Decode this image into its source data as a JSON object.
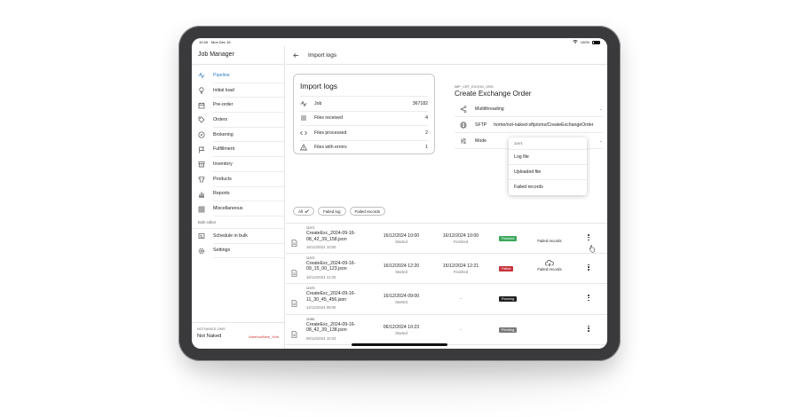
{
  "status_bar": {
    "time": "10:45",
    "date": "Mon Dec 16",
    "battery": "100%"
  },
  "sidebar": {
    "title": "Job Manager",
    "items": [
      {
        "label": "Pipeline",
        "icon": "pipeline-icon",
        "active": true
      },
      {
        "label": "Initial load",
        "icon": "bulb-icon"
      },
      {
        "label": "Pre-order",
        "icon": "calendar-icon"
      },
      {
        "label": "Orders",
        "icon": "tag-icon"
      },
      {
        "label": "Brokering",
        "icon": "compass-icon"
      },
      {
        "label": "Fulfillment",
        "icon": "flag-icon"
      },
      {
        "label": "Inventory",
        "icon": "box-icon"
      },
      {
        "label": "Products",
        "icon": "shirt-icon"
      },
      {
        "label": "Reports",
        "icon": "bar-chart-icon"
      },
      {
        "label": "Miscellaneous",
        "icon": "grid-icon"
      }
    ],
    "section_label": "Bulk editor",
    "bulk_items": [
      {
        "label": "Schedule in bulk",
        "icon": "schedule-icon"
      },
      {
        "label": "Settings",
        "icon": "gear-icon"
      }
    ],
    "footer": {
      "org": "NOTNAKED-OMS",
      "name": "Not Naked",
      "timezone": "America/New_York"
    }
  },
  "header": {
    "title": "Import logs"
  },
  "summary": {
    "title": "Import logs",
    "rows": [
      {
        "label": "Job",
        "value": "367182",
        "icon": "pipeline-icon"
      },
      {
        "label": "Files received",
        "value": "4",
        "icon": "list-icon"
      },
      {
        "label": "Files processed",
        "value": "2",
        "icon": "code-icon"
      },
      {
        "label": "Files with errors",
        "value": "1",
        "icon": "warning-icon"
      }
    ]
  },
  "job_detail": {
    "code": "IMP_CRT_EXCHG_ORD",
    "title": "Create Exchange Order",
    "rows": [
      {
        "label": "Multithreading",
        "value": "",
        "icon": "share-icon"
      },
      {
        "label": "SFTP",
        "value": "home/not-naked-sftp/oms/CreateExchangeOrder",
        "icon": "globe-icon"
      },
      {
        "label": "Mode",
        "value": "",
        "icon": "sliders-icon"
      }
    ]
  },
  "filters": [
    "All",
    "Failed log",
    "Failed records"
  ],
  "logs": [
    {
      "id": "11971",
      "name": "CreateExc_2024-09-16-08_42_39_158.json",
      "date": "16/12/2024 10:00",
      "started": "16/12/2024 10:00",
      "started_label": "Started",
      "finished": "16/12/2024 10:00",
      "finished_label": "Finished",
      "status": "Finished",
      "status_color": "#3aa85a",
      "failed_records": "Failed records"
    },
    {
      "id": "11972",
      "name": "CreateExc_2024-09-16-09_15_00_123.json",
      "date": "15/12/2024 12:20",
      "started": "16/12/2024 12:20",
      "started_label": "Started",
      "finished": "15/12/2024 12:21",
      "finished_label": "Finished",
      "status": "Failed",
      "status_color": "#c8323a",
      "failed_records": "Failed records"
    },
    {
      "id": "11979",
      "name": "CreateExc_2024-09-16-11_30_45_456.json",
      "date": "12/12/2024 09:00",
      "started": "16/12/2024 09:00",
      "started_label": "Started",
      "finished": "-",
      "status": "Running",
      "status_color": "#202020"
    },
    {
      "id": "11981",
      "name": "CreateExc_2024-09-16-08_42_39_138.json",
      "date": "06/12/2024 10:23",
      "started": "06/12/2024 10:23",
      "started_label": "Started",
      "finished": "-",
      "status": "Pending",
      "status_color": "#7a7a7a"
    }
  ],
  "context_menu": {
    "header": "11971",
    "items": [
      "Log file",
      "Uploaded file",
      "Failed records"
    ]
  }
}
